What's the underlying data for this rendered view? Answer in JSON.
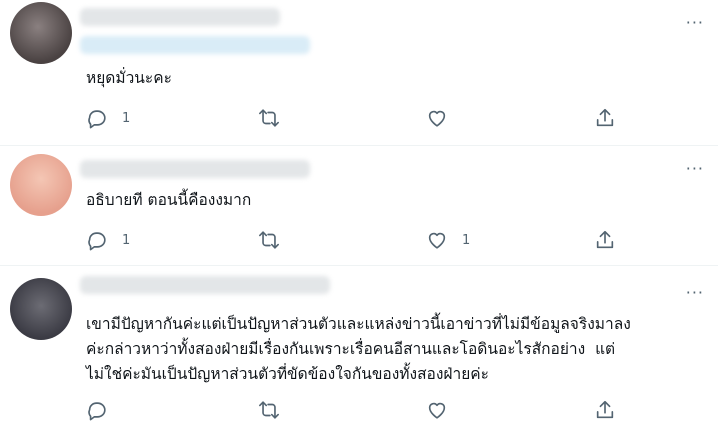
{
  "icons": {
    "more": "more-horizontal-icon",
    "reply": "reply-icon",
    "retweet": "retweet-icon",
    "like": "heart-icon",
    "share": "share-icon"
  },
  "colors": {
    "text": "#0f1419",
    "secondary": "#536471",
    "divider": "#eff3f4"
  },
  "more_glyph": "···",
  "tweets": [
    {
      "text": "หยุดมั่วนะคะ",
      "replies": "1",
      "retweets": "",
      "likes": ""
    },
    {
      "text": "อธิบายที ตอนนี้คืองงมาก",
      "replies": "1",
      "retweets": "",
      "likes": "1"
    },
    {
      "text": "เขามีปัญหากันค่ะแต่เป็นปัญหาส่วนตัวและแหล่งข่าวนี้เอาข่าวที่ไม่มีข้อมูลจริงมาลง\nค่ะกล่าวหาว่าทั้งสองฝ่ายมีเรื่องกันเพราะเรื่อคนอีสานและโอดินอะไรสักอย่าง  แต่\nไม่ใช่ค่ะมันเป็นปัญหาส่วนตัวที่ขัดข้องใจกันของทั้งสองฝ่ายค่ะ",
      "replies": "",
      "retweets": "",
      "likes": ""
    }
  ]
}
